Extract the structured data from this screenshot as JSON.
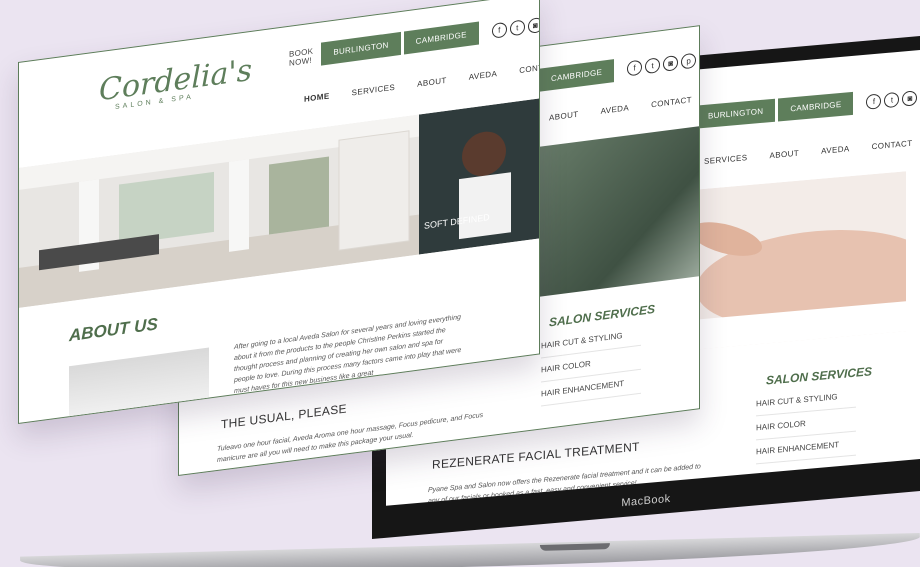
{
  "brand": {
    "name": "Cordelia's",
    "tagline": "SALON & SPA",
    "accent": "#5e7e5b"
  },
  "topbar": {
    "book_now": "BOOK NOW!",
    "locations": [
      "BURLINGTON",
      "CAMBRIDGE"
    ],
    "social_icons": [
      "facebook-icon",
      "twitter-icon",
      "instagram-icon",
      "pinterest-icon"
    ]
  },
  "nav": {
    "home": "HOME",
    "services": "SERVICES",
    "about": "ABOUT",
    "aveda": "AVEDA",
    "contact": "CONTACT"
  },
  "front_page": {
    "heading": "ABOUT US",
    "paragraph": "After going to a local Aveda Salon for several years and loving everything about it from the products to the people Christine Perkins started the thought process and planning of creating her own salon and spa for people to love. During this process many factors came into play that were must haves for this new business like a great",
    "banner_text": "SOFT DEFINED"
  },
  "middle_page": {
    "services_title": "SALON SERVICES",
    "services": [
      "HAIR CUT & STYLING",
      "HAIR COLOR",
      "HAIR ENHANCEMENT"
    ],
    "subhead": "THE USUAL, PLEASE",
    "paragraph": "Tuleavo one hour facial, Aveda Aroma one hour massage, Focus pedicure, and Focus manicure are all you will need to make this package your usual."
  },
  "laptop_page": {
    "services_title": "SALON SERVICES",
    "services": [
      "HAIR CUT & STYLING",
      "HAIR COLOR",
      "HAIR ENHANCEMENT"
    ],
    "subhead": "REZENERATE FACIAL TREATMENT",
    "paragraph": "Pyane Spa and Salon now offers the Rezenerate facial treatment and it can be added to any of our facials or booked as a fast, easy and convenient service!"
  },
  "device": {
    "label": "MacBook"
  }
}
